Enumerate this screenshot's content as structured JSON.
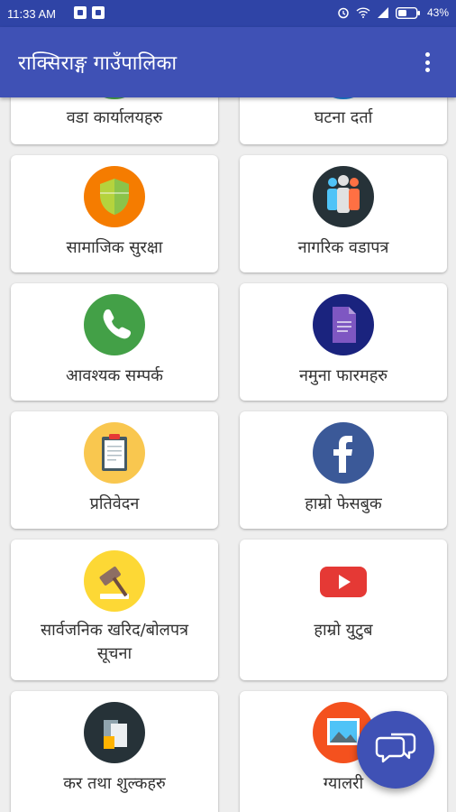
{
  "status_bar": {
    "time": "11:33 AM",
    "battery": "43%"
  },
  "app_bar": {
    "title": "राक्सिराङ्ग गाउँपालिका"
  },
  "cards": [
    {
      "label": "वडा कार्यालयहरु",
      "icon": "office-icon",
      "color": "#4caf50"
    },
    {
      "label": "घटना दर्ता",
      "icon": "register-icon",
      "color": "#1e88e5"
    },
    {
      "label": "सामाजिक सुरक्षा",
      "icon": "shield-icon",
      "color": "#f57c00"
    },
    {
      "label": "नागरिक वडापत्र",
      "icon": "people-icon",
      "color": "#263238"
    },
    {
      "label": "आवश्यक सम्पर्क",
      "icon": "phone-icon",
      "color": "#43a047"
    },
    {
      "label": "नमुना फारमहरु",
      "icon": "form-icon",
      "color": "#1a237e"
    },
    {
      "label": "प्रतिवेदन",
      "icon": "clipboard-icon",
      "color": "#f9c74f"
    },
    {
      "label": "हाम्रो फेसबुक",
      "icon": "facebook-icon",
      "color": "#3b5998"
    },
    {
      "label": "सार्वजनिक खरिद/बोलपत्र",
      "label2": "सूचना",
      "icon": "gavel-icon",
      "color": "#fdd835"
    },
    {
      "label": "हाम्रो युटुब",
      "icon": "youtube-icon",
      "color": "#e53935"
    },
    {
      "label": "कर तथा शुल्कहरु",
      "icon": "tax-documents-icon",
      "color": "#263238"
    },
    {
      "label": "ग्यालरी",
      "icon": "gallery-icon",
      "color": "#f4511e"
    }
  ],
  "fab": {
    "icon": "chat-icon"
  }
}
